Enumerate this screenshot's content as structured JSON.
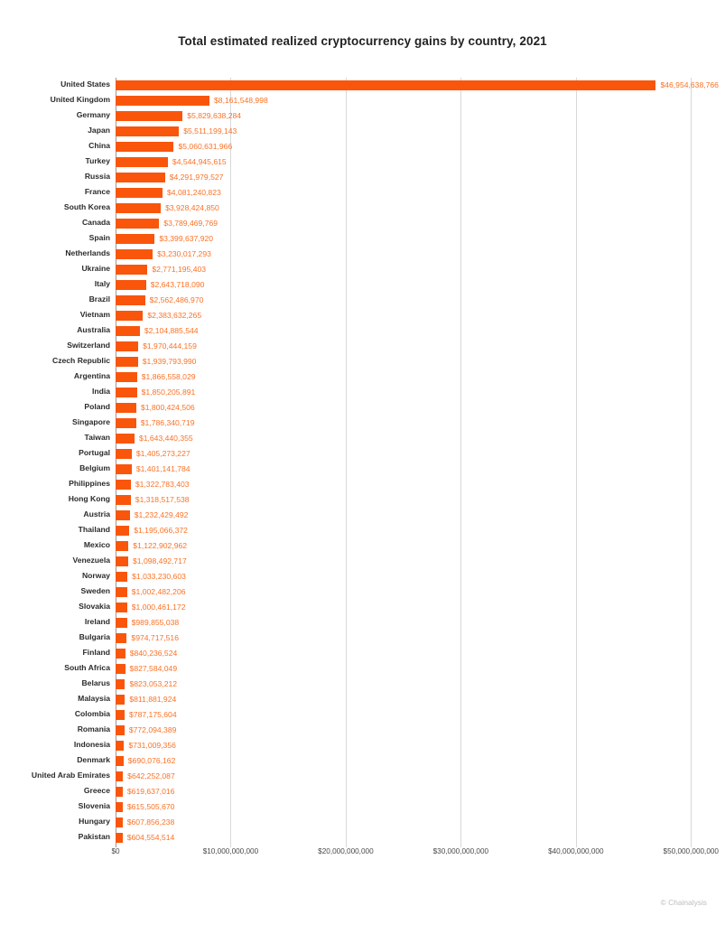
{
  "chart_data": {
    "type": "bar",
    "orientation": "horizontal",
    "title": "Total estimated realized cryptocurrency gains by country, 2021",
    "xlabel": "",
    "ylabel": "",
    "xlim": [
      0,
      51000000000
    ],
    "grid": true,
    "legend": null,
    "x_ticks": [
      "$0",
      "$10,000,000,000",
      "$20,000,000,000",
      "$30,000,000,000",
      "$40,000,000,000",
      "$50,000,000,000"
    ],
    "x_tick_values": [
      0,
      10000000000,
      20000000000,
      30000000000,
      40000000000,
      50000000000
    ],
    "categories": [
      "United States",
      "United Kingdom",
      "Germany",
      "Japan",
      "China",
      "Turkey",
      "Russia",
      "France",
      "South Korea",
      "Canada",
      "Spain",
      "Netherlands",
      "Ukraine",
      "Italy",
      "Brazil",
      "Vietnam",
      "Australia",
      "Switzerland",
      "Czech Republic",
      "Argentina",
      "India",
      "Poland",
      "Singapore",
      "Taiwan",
      "Portugal",
      "Belgium",
      "Philippines",
      "Hong Kong",
      "Austria",
      "Thailand",
      "Mexico",
      "Venezuela",
      "Norway",
      "Sweden",
      "Slovakia",
      "Ireland",
      "Bulgaria",
      "Finland",
      "South Africa",
      "Belarus",
      "Malaysia",
      "Colombia",
      "Romania",
      "Indonesia",
      "Denmark",
      "United Arab Emirates",
      "Greece",
      "Slovenia",
      "Hungary",
      "Pakistan"
    ],
    "values": [
      46954638766,
      8161548998,
      5829638284,
      5511199143,
      5060631966,
      4544945615,
      4291979527,
      4081240823,
      3928424850,
      3789469769,
      3399637920,
      3230017293,
      2771195403,
      2643718090,
      2562486970,
      2383632265,
      2104885544,
      1970444159,
      1939793990,
      1866558029,
      1850205891,
      1800424506,
      1786340719,
      1643440355,
      1405273227,
      1401141784,
      1322783403,
      1318517538,
      1232429492,
      1195066372,
      1122902962,
      1098492717,
      1033230603,
      1002482206,
      1000461172,
      989855038,
      974717516,
      840236524,
      827584049,
      823053212,
      811881924,
      787175604,
      772094389,
      731009356,
      690076162,
      642252087,
      619637016,
      615505670,
      607856238,
      604554514
    ],
    "value_labels": [
      "$46,954,638,766",
      "$8,161,548,998",
      "$5,829,638,284",
      "$5,511,199,143",
      "$5,060,631,966",
      "$4,544,945,615",
      "$4,291,979,527",
      "$4,081,240,823",
      "$3,928,424,850",
      "$3,789,469,769",
      "$3,399,637,920",
      "$3,230,017,293",
      "$2,771,195,403",
      "$2,643,718,090",
      "$2,562,486,970",
      "$2,383,632,265",
      "$2,104,885,544",
      "$1,970,444,159",
      "$1,939,793,990",
      "$1,866,558,029",
      "$1,850,205,891",
      "$1,800,424,506",
      "$1,786,340,719",
      "$1,643,440,355",
      "$1,405,273,227",
      "$1,401,141,784",
      "$1,322,783,403",
      "$1,318,517,538",
      "$1,232,429,492",
      "$1,195,066,372",
      "$1,122,902,962",
      "$1,098,492,717",
      "$1,033,230,603",
      "$1,002,482,206",
      "$1,000,461,172",
      "$989,855,038",
      "$974,717,516",
      "$840,236,524",
      "$827,584,049",
      "$823,053,212",
      "$811,881,924",
      "$787,175,604",
      "$772,094,389",
      "$731,009,356",
      "$690,076,162",
      "$642,252,087",
      "$619,637,016",
      "$615,505,670",
      "$607,856,238",
      "$604,554,514"
    ],
    "bar_color": "#f9560b",
    "value_label_color": "#fb7226"
  },
  "credit": "© Chainalysis"
}
